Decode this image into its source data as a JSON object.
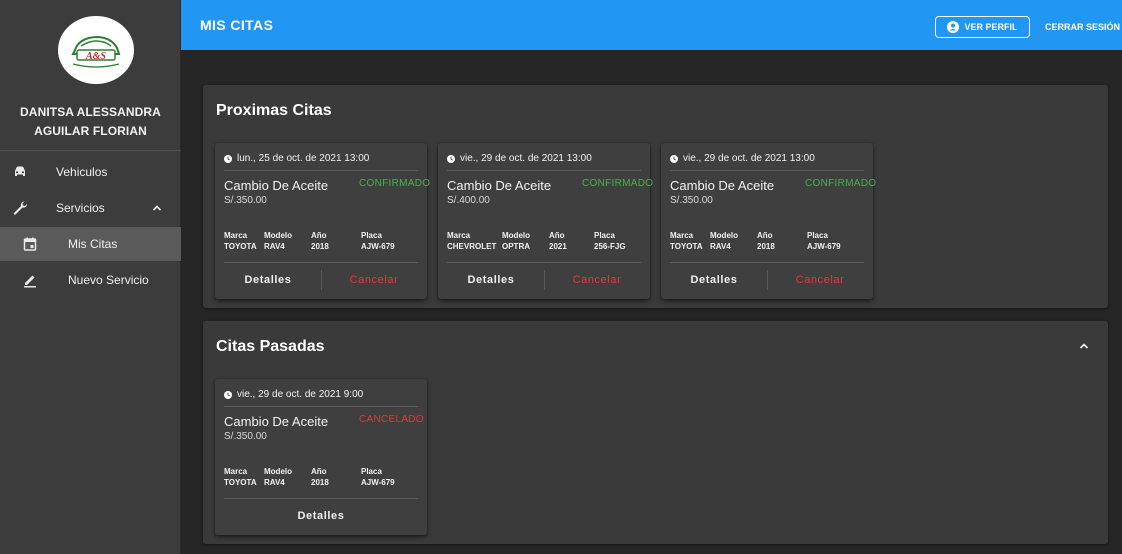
{
  "sidebar": {
    "logo_text": "A&S",
    "user_name_line1": "DANITSA ALESSANDRA",
    "user_name_line2": "AGUILAR FLORIAN",
    "items": [
      {
        "label": "Vehiculos",
        "icon": "car-icon"
      },
      {
        "label": "Servicios",
        "icon": "wrench-icon"
      },
      {
        "label": "Mis Citas",
        "icon": "calendar-icon"
      },
      {
        "label": "Nuevo Servicio",
        "icon": "pencil-icon"
      }
    ]
  },
  "header": {
    "title": "MIS CITAS",
    "profile_button": "VER PERFIL",
    "logout_button": "CERRAR SESIÓN"
  },
  "upcoming": {
    "title": "Proximas Citas",
    "cards": [
      {
        "date": "lun., 25 de oct. de 2021 13:00",
        "service": "Cambio De Aceite",
        "status": "CONFIRMADO",
        "price": "S/.350.00",
        "vehicle": {
          "marca": "TOYOTA",
          "modelo": "RAV4",
          "anio": "2018",
          "placa": "AJW-679"
        }
      },
      {
        "date": "vie., 29 de oct. de 2021 13:00",
        "service": "Cambio De Aceite",
        "status": "CONFIRMADO",
        "price": "S/.400.00",
        "vehicle": {
          "marca": "CHEVROLET",
          "modelo": "OPTRA",
          "anio": "2021",
          "placa": "256-FJG"
        }
      },
      {
        "date": "vie., 29 de oct. de 2021 13:00",
        "service": "Cambio De Aceite",
        "status": "CONFIRMADO",
        "price": "S/.350.00",
        "vehicle": {
          "marca": "TOYOTA",
          "modelo": "RAV4",
          "anio": "2018",
          "placa": "AJW-679"
        }
      }
    ]
  },
  "past": {
    "title": "Citas Pasadas",
    "cards": [
      {
        "date": "vie., 29 de oct. de 2021 9:00",
        "service": "Cambio De Aceite",
        "status": "CANCELADO",
        "price": "S/.350.00",
        "vehicle": {
          "marca": "TOYOTA",
          "modelo": "RAV4",
          "anio": "2018",
          "placa": "AJW-679"
        }
      }
    ]
  },
  "labels": {
    "marca": "Marca",
    "modelo": "Modelo",
    "anio": "Año",
    "placa": "Placa",
    "details": "Detalles",
    "cancel": "Cancelar"
  },
  "colors": {
    "app_bar": "#2196f3",
    "confirmed": "#4caf50",
    "cancelled": "#e53935"
  }
}
